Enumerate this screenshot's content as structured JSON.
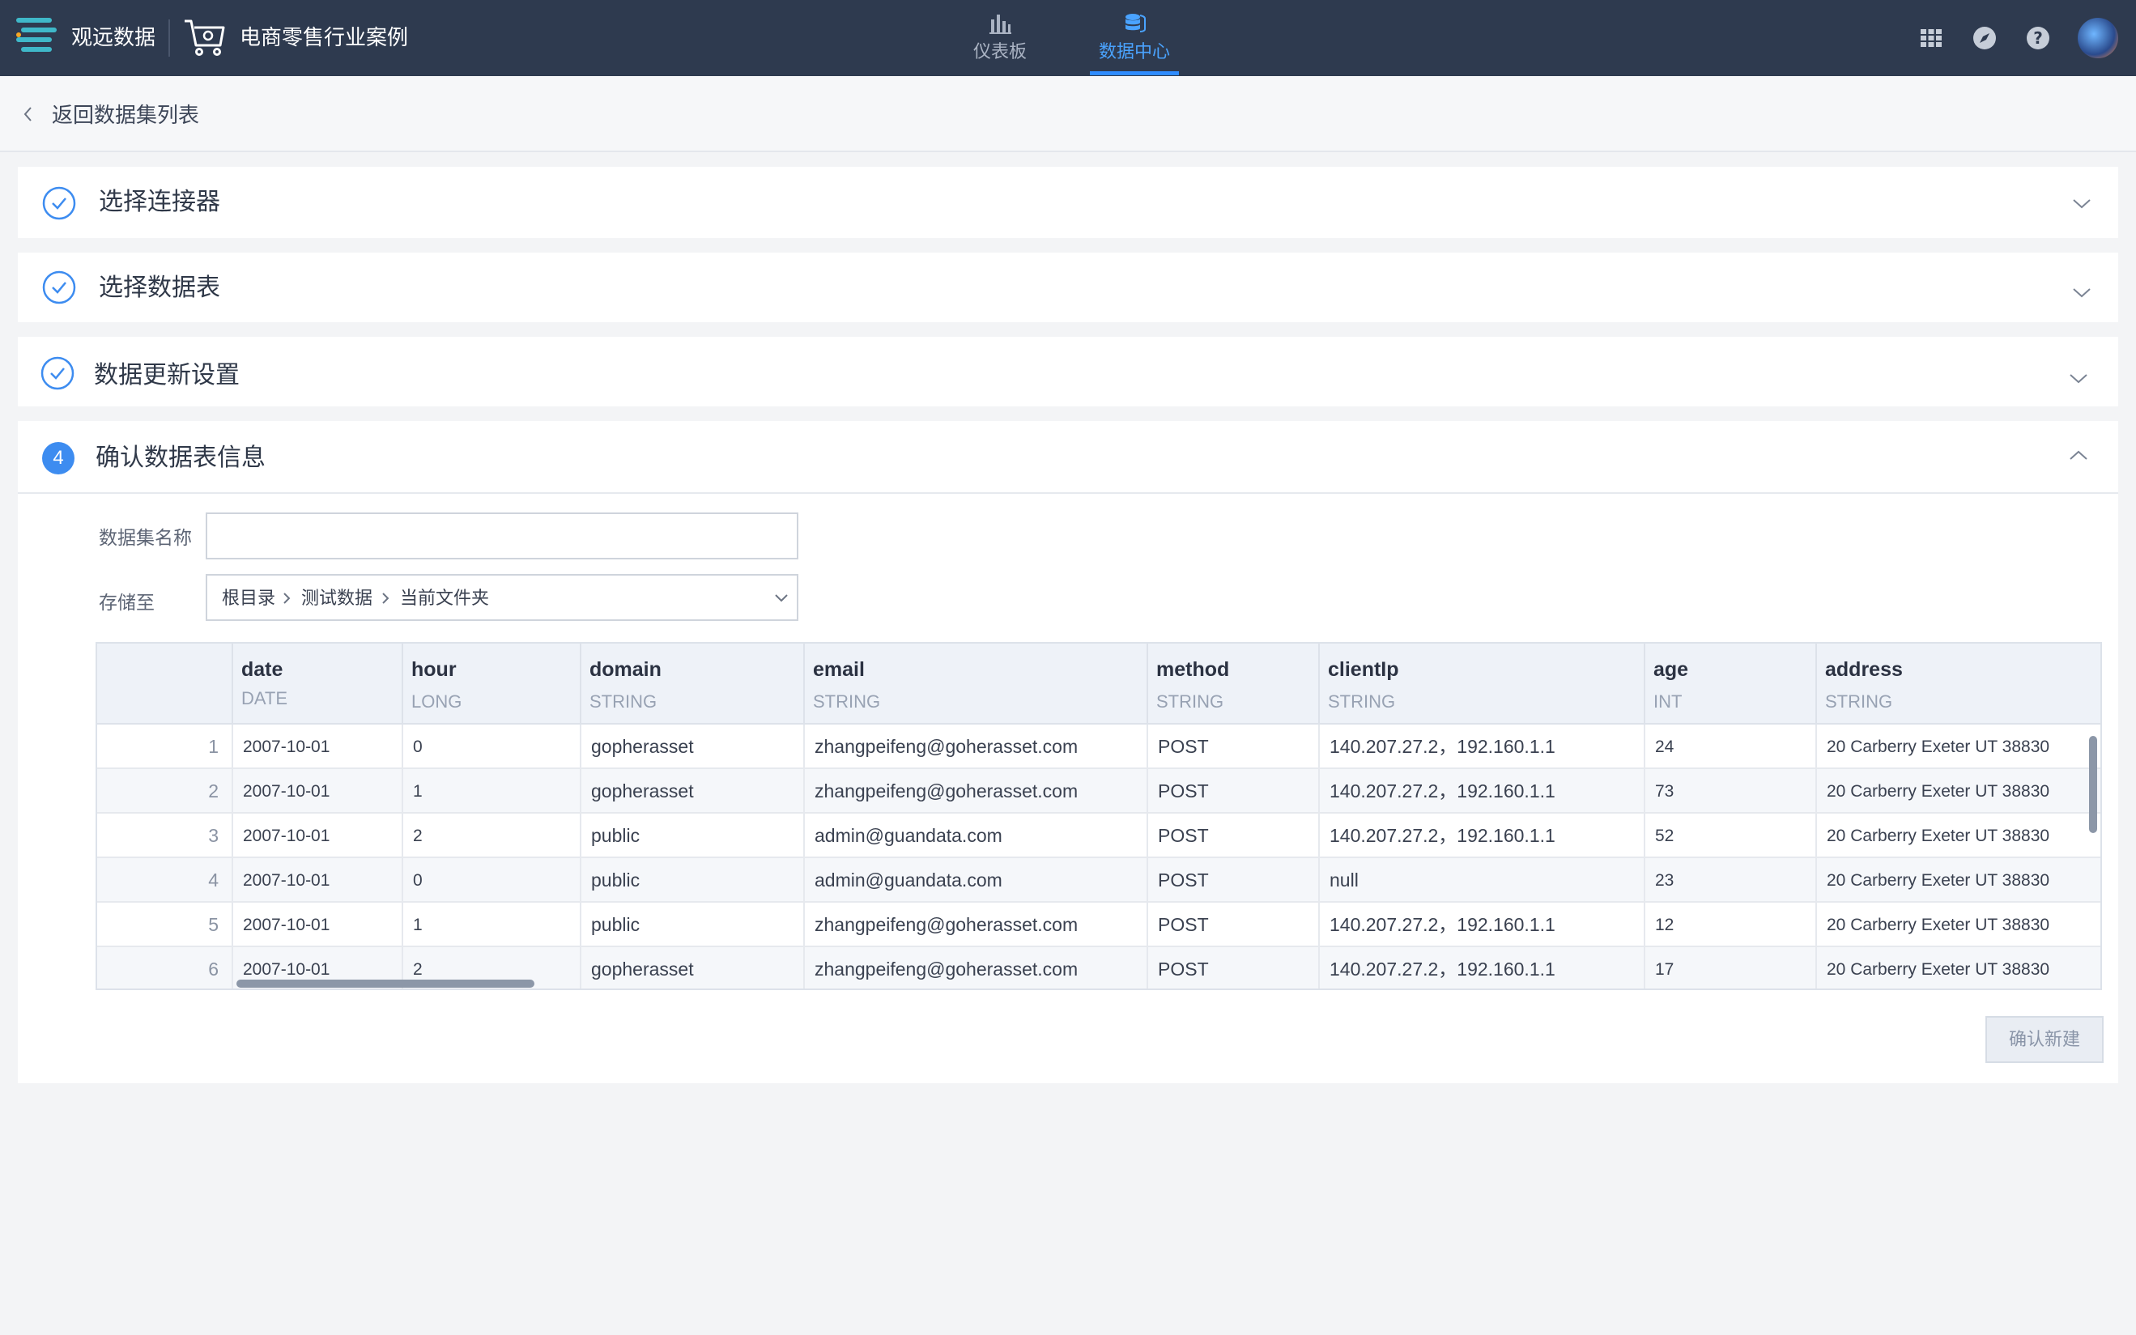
{
  "header": {
    "brand": "观远数据",
    "project": "电商零售行业案例",
    "nav": [
      {
        "label": "仪表板",
        "icon": "bar-chart-icon",
        "active": false
      },
      {
        "label": "数据中心",
        "icon": "database-icon",
        "active": true
      }
    ],
    "icons": [
      "apps-grid-icon",
      "compass-icon",
      "help-icon",
      "avatar"
    ],
    "colors": {
      "bar": "#2e3a4f",
      "active": "#2f8cff"
    }
  },
  "back": {
    "label": "返回数据集列表"
  },
  "steps": [
    {
      "title": "选择连接器",
      "status": "done"
    },
    {
      "title": "选择数据表",
      "status": "done"
    },
    {
      "title": "数据更新设置",
      "status": "done"
    },
    {
      "title": "确认数据表信息",
      "status": "active",
      "number": "4"
    }
  ],
  "form": {
    "name_label": "数据集名称",
    "name_value": "",
    "store_label": "存储至",
    "path": [
      "根目录",
      "测试数据",
      "当前文件夹"
    ]
  },
  "table": {
    "columns": [
      {
        "name": "date",
        "type": "DATE"
      },
      {
        "name": "hour",
        "type": "LONG"
      },
      {
        "name": "domain",
        "type": "STRING"
      },
      {
        "name": "email",
        "type": "STRING"
      },
      {
        "name": "method",
        "type": "STRING"
      },
      {
        "name": "clientIp",
        "type": "STRING"
      },
      {
        "name": "age",
        "type": "INT"
      },
      {
        "name": "address",
        "type": "STRING"
      }
    ],
    "rows": [
      {
        "idx": "1",
        "cells": [
          "2007-10-01",
          "0",
          "gopherasset",
          "zhangpeifeng@goherasset.com",
          "POST",
          "140.207.27.2，192.160.1.1",
          "24",
          "20 Carberry  Exeter UT 38830"
        ]
      },
      {
        "idx": "2",
        "cells": [
          "2007-10-01",
          "1",
          "gopherasset",
          "zhangpeifeng@goherasset.com",
          "POST",
          "140.207.27.2，192.160.1.1",
          "73",
          "20 Carberry  Exeter UT 38830"
        ]
      },
      {
        "idx": "3",
        "cells": [
          "2007-10-01",
          "2",
          "public",
          "admin@guandata.com",
          "POST",
          "140.207.27.2，192.160.1.1",
          "52",
          "20 Carberry  Exeter UT 38830"
        ]
      },
      {
        "idx": "4",
        "cells": [
          "2007-10-01",
          "0",
          "public",
          "admin@guandata.com",
          "POST",
          "null",
          "23",
          "20 Carberry  Exeter UT 38830"
        ]
      },
      {
        "idx": "5",
        "cells": [
          "2007-10-01",
          "1",
          "public",
          "zhangpeifeng@goherasset.com",
          "POST",
          "140.207.27.2，192.160.1.1",
          "12",
          "20 Carberry  Exeter UT 38830"
        ]
      },
      {
        "idx": "6",
        "cells": [
          "2007-10-01",
          "2",
          "gopherasset",
          "zhangpeifeng@goherasset.com",
          "POST",
          "140.207.27.2，192.160.1.1",
          "17",
          "20 Carberry  Exeter UT 38830"
        ]
      }
    ]
  },
  "actions": {
    "confirm_label": "确认新建"
  }
}
